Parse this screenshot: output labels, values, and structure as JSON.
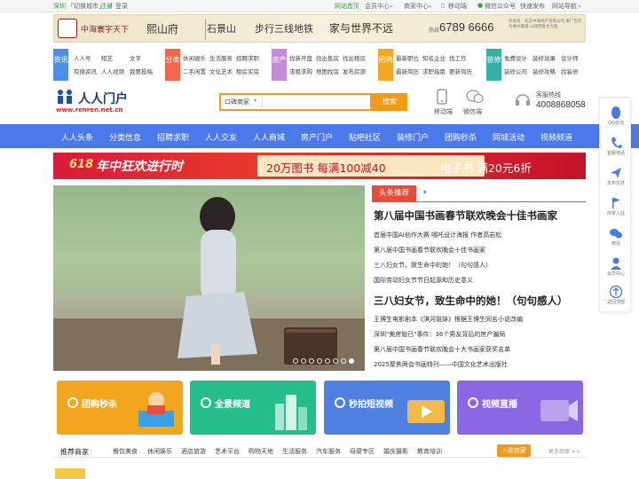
{
  "topbar": {
    "city": "深圳",
    "switch_city": "「切换城市」",
    "register": "注册",
    "login": "登录",
    "links": [
      "网站首页",
      "会员中心",
      "商家中心",
      "移动端",
      "微信公众号",
      "快速发布",
      "网站导航"
    ]
  },
  "banner": {
    "left_brand": "中海寰宇天下",
    "left_name": "熙山府",
    "project": "石景山",
    "slogan": "步行三线地铁",
    "tagline": "家与世界不远",
    "phone_prefix": "热线",
    "phone": "6789 6666",
    "fine_print": "开发商：北京中海地产有限公司 本广告仅为要约邀请 以政府批文为准"
  },
  "categories": [
    {
      "badge": "资讯",
      "color": "#4f8fe3",
      "items": [
        "人人号",
        "短艺",
        "文字",
        "有偿资讯",
        "人人视频",
        "我要投稿"
      ]
    },
    {
      "badge": "分类",
      "color": "#f2654a",
      "items": [
        "休闲娱乐",
        "生活服务",
        "招聘求职",
        "二手闲置",
        "文化艺术",
        "租房买房"
      ]
    },
    {
      "badge": "房产",
      "color": "#c58bdc",
      "items": [
        "找新开盘",
        "找出售房",
        "找出租房",
        "求租求购",
        "地图找房",
        "发布房源"
      ]
    },
    {
      "badge": "招聘",
      "color": "#f5a623",
      "items": [
        "最新职位",
        "知名企业",
        "找工作",
        "最新简历",
        "求职指南",
        "更新简历"
      ]
    },
    {
      "badge": "装修",
      "color": "#35b0a6",
      "items": [
        "免费设计",
        "装修效果",
        "设计师",
        "装修公司",
        "装修攻略",
        "找装修"
      ]
    }
  ],
  "logo": {
    "text": "人人门户",
    "url": "www.renren.net.cn"
  },
  "search": {
    "type": "口碑商家",
    "placeholder": "",
    "button": "搜索"
  },
  "header_links": {
    "mobile": "移动端",
    "wechat": "微信端",
    "hotline_label": "客服热线",
    "hotline": "4008868058"
  },
  "nav": [
    "人人头条",
    "分类信息",
    "招聘求职",
    "人人交友",
    "人人商城",
    "房产门户",
    "贴吧社区",
    "装修门户",
    "团购秒杀",
    "同城活动",
    "视频频道"
  ],
  "promo": {
    "logo": "618",
    "main": "年中狂欢进行时",
    "book_offer": "20万图书 每满100减40",
    "ebook_offer": "电子书 满20元6折"
  },
  "slider": {
    "dot_count": 8,
    "active_dot": 7
  },
  "headlines": {
    "tag": "头条推荐",
    "headline1": "第八届中国书画春节联欢晚会十佳书画家",
    "list1": [
      "首届中国AI创作大赛 哪吒设计海报 作者高岩松",
      "第八届中国书画春节联欢晚会十佳书画家",
      "三八妇女节，致生命中的她！（句句感人）",
      "国际劳动妇女节节日起源和历史意义"
    ],
    "headline2": "三八妇女节，致生命中的她！（句句感人）",
    "list2": [
      "王博生电影剧本《淇河姐妹》根据王博生同名小说改编",
      "深圳\"美房媳已\"事件：36个男友背后的房产骗局",
      "第八届中国书画春节联欢晚会十大书画家获奖名单",
      "2025聚焦两会书画特刊——中国文化艺术出版社"
    ]
  },
  "cards": [
    {
      "title": "团购秒杀",
      "color": "#f2a61f"
    },
    {
      "title": "全景频道",
      "color": "#25bd8c"
    },
    {
      "title": "秒拍短视频",
      "color": "#4f7fe0"
    },
    {
      "title": "视频直播",
      "color": "#8c67e3"
    }
  ],
  "merchant_tabs": {
    "title": "推荐商家",
    "tabs": [
      "餐饮美食",
      "休闲娱乐",
      "酒店旅游",
      "艺术平台",
      "购物天地",
      "生活服务",
      "汽车服务",
      "母婴专区",
      "婚庆摄影",
      "教育培训"
    ],
    "join": "入驻商家",
    "more": "更多商家 >>"
  },
  "sidebar": [
    {
      "label": "QQ咨询",
      "icon": "qq-icon"
    },
    {
      "label": "客服电话",
      "icon": "phone-icon"
    },
    {
      "label": "发布信息",
      "icon": "send-icon"
    },
    {
      "label": "商家入驻",
      "icon": "flag-icon"
    },
    {
      "label": "微信",
      "icon": "wechat-icon"
    },
    {
      "label": "会员中心",
      "icon": "user-icon"
    },
    {
      "label": "返回顶部",
      "icon": "top-icon"
    }
  ]
}
